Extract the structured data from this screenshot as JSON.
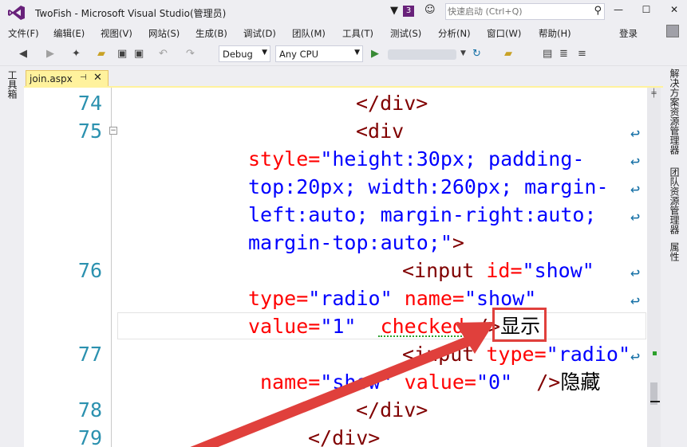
{
  "window": {
    "title": "TwoFish - Microsoft Visual Studio(管理员)",
    "notification_count": "3",
    "quick_launch_placeholder": "快速启动 (Ctrl+Q)"
  },
  "menu": {
    "items": [
      "文件(F)",
      "编辑(E)",
      "视图(V)",
      "网站(S)",
      "生成(B)",
      "调试(D)",
      "团队(M)",
      "工具(T)",
      "测试(S)",
      "分析(N)",
      "窗口(W)",
      "帮助(H)"
    ],
    "sign_in": "登录"
  },
  "toolbar": {
    "configuration": "Debug",
    "platform": "Any CPU"
  },
  "side_panels": {
    "left": "工具箱",
    "right_1": "解决方案资源管理器",
    "right_2": "团队资源管理器",
    "right_3": "属性"
  },
  "tab": {
    "label": "join.aspx",
    "pin": "⊣",
    "close": "✕"
  },
  "editor": {
    "line_numbers": [
      "74",
      "75",
      "76",
      "77",
      "78",
      "79"
    ],
    "code": {
      "l74": "</div>",
      "l75": "<div",
      "l75_w1_attr": "style=",
      "l75_w1_val": "\"height:30px; padding-",
      "l75_w2_val": "top:20px; width:260px; margin-",
      "l75_w3_val": "left:auto; margin-right:auto;",
      "l75_w4_val": "margin-top:auto;\"",
      "l75_w4_tag": ">",
      "l76_tag": "<input",
      "l76_attr1": "id=",
      "l76_val1": "\"show\"",
      "l76_w1_attr1": "type=",
      "l76_w1_val1": "\"radio\"",
      "l76_w1_attr2": "name=",
      "l76_w1_val2": "\"show\"",
      "l76_w2_attr1": "value=",
      "l76_w2_val1": "\"1\"",
      "l76_w2_attr2": "checked",
      "l76_w2_tag": "/>",
      "l76_w2_text": "显示",
      "l77_tag": "<input",
      "l77_attr1": "type=",
      "l77_val1": "\"radio\"",
      "l77_w1_attr1": "name=",
      "l77_w1_val1": "\"show\"",
      "l77_w1_attr2": "value=",
      "l77_w1_val2": "\"0\"",
      "l77_w1_tag": "/>",
      "l77_w1_text": "隐藏",
      "l78": "</div>",
      "l79": "</div>"
    }
  },
  "colors": {
    "accent": "#68217A",
    "tab_active": "#FFF29D",
    "annotation": "#E0403C"
  }
}
